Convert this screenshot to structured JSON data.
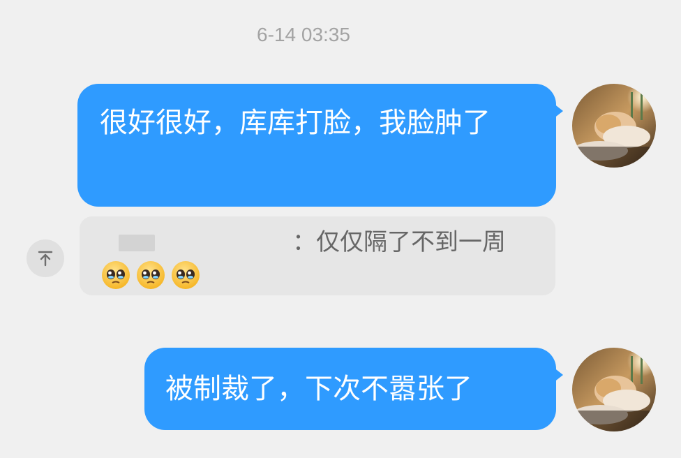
{
  "conversation": {
    "timestamp": "6-14 03:35"
  },
  "messages": [
    {
      "side": "right",
      "text": "很好很好，库库打脸，我脸肿了",
      "bubble_color": "#2f9bff"
    },
    {
      "side": "right",
      "text": "被制裁了，下次不嚣张了",
      "bubble_color": "#2f9bff"
    }
  ],
  "quote": {
    "sender_label_redacted": true,
    "separator": "：",
    "text": "仅仅隔了不到一周",
    "emojis": [
      "pleading-face-emoji",
      "pleading-face-emoji",
      "pleading-face-emoji"
    ],
    "jump_icon": "jump-to-top-icon"
  },
  "user": {
    "avatar_icon": "user-avatar"
  }
}
